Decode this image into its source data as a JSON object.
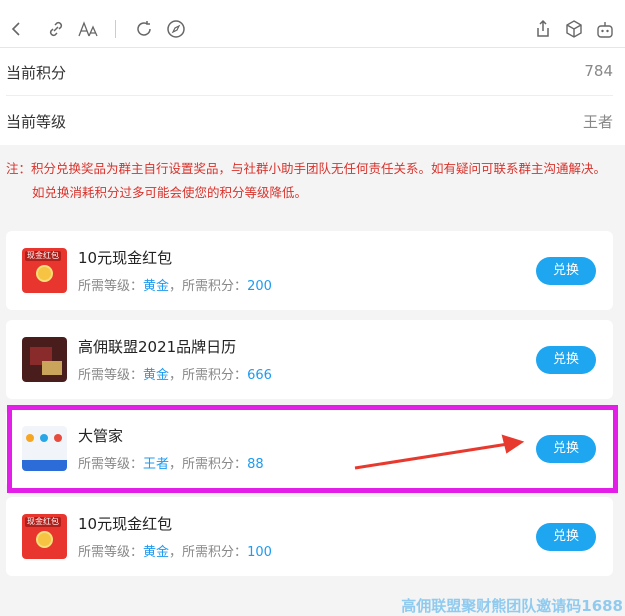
{
  "toolbar": {
    "icons": [
      "back-icon",
      "link-icon",
      "font-size-icon",
      "refresh-icon",
      "compass-icon",
      "share-icon",
      "cube-icon",
      "robot-icon"
    ]
  },
  "points": {
    "label": "当前积分",
    "value": "784"
  },
  "level": {
    "label": "当前等级",
    "value": "王者"
  },
  "notice": {
    "line1": "注：积分兑换奖品为群主自行设置奖品，与社群小助手团队无任何责任关系。如有疑问可联系群主沟通解决。",
    "line2": "如兑换消耗积分过多可能会使您的积分等级降低。"
  },
  "rewards": [
    {
      "title": "10元现金红包",
      "req_level_label": "所需等级：",
      "req_level": "黄金",
      "sep": "，",
      "req_points_label": "所需积分：",
      "req_points": "200",
      "button": "兑换",
      "thumb_tag": "现金红包"
    },
    {
      "title": "高佣联盟2021品牌日历",
      "req_level_label": "所需等级：",
      "req_level": "黄金",
      "sep": "，",
      "req_points_label": "所需积分：",
      "req_points": "666",
      "button": "兑换"
    },
    {
      "title": "大管家",
      "req_level_label": "所需等级：",
      "req_level": "王者",
      "sep": "，",
      "req_points_label": "所需积分：",
      "req_points": "88",
      "button": "兑换"
    },
    {
      "title": "10元现金红包",
      "req_level_label": "所需等级：",
      "req_level": "黄金",
      "sep": "，",
      "req_points_label": "所需积分：",
      "req_points": "100",
      "button": "兑换",
      "thumb_tag": "现金红包"
    }
  ],
  "colors": {
    "accent": "#1ea6f1",
    "notice": "#d9322c",
    "highlight": "#e21ee8",
    "arrow": "#e8392e"
  },
  "watermark": "高佣联盟聚财熊团队邀请码1688"
}
